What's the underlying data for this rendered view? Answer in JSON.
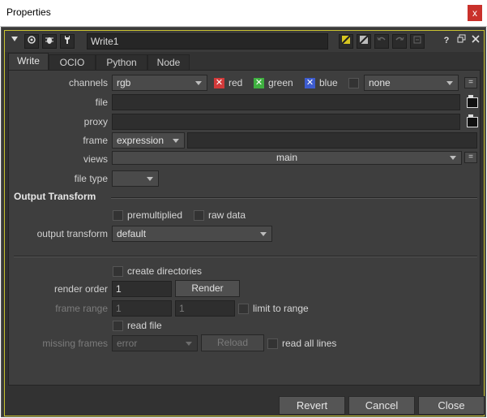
{
  "window": {
    "title": "Properties",
    "close_glyph": "x"
  },
  "toolbar": {
    "node_name": "Write1",
    "help": "?"
  },
  "tabs": [
    "Write",
    "OCIO",
    "Python",
    "Node"
  ],
  "channels": {
    "label": "channels",
    "value": "rgb",
    "red": "red",
    "green": "green",
    "blue": "blue",
    "alpha_value": "none",
    "red_color": "#d23a3a",
    "green_color": "#3fb040",
    "blue_color": "#3d5ccf"
  },
  "file": {
    "label": "file",
    "value": ""
  },
  "proxy": {
    "label": "proxy",
    "value": ""
  },
  "frame": {
    "label": "frame",
    "mode": "expression",
    "value": ""
  },
  "views": {
    "label": "views",
    "value": "main"
  },
  "file_type": {
    "label": "file type",
    "value": ""
  },
  "output_transform": {
    "section": "Output Transform",
    "premultiplied": "premultiplied",
    "raw_data": "raw data",
    "label": "output transform",
    "value": "default"
  },
  "render": {
    "create_directories": "create directories",
    "render_order_label": "render order",
    "render_order": "1",
    "render_button": "Render",
    "frame_range_label": "frame range",
    "range_start": "1",
    "range_end": "1",
    "limit_to_range": "limit to range",
    "read_file": "read file",
    "missing_frames_label": "missing frames",
    "missing_frames": "error",
    "reload_button": "Reload",
    "read_all_lines": "read all lines"
  },
  "footer": {
    "revert": "Revert",
    "cancel": "Cancel",
    "close": "Close"
  },
  "colors": {
    "panel_border": "#c9c230",
    "close_red": "#c9312b"
  }
}
